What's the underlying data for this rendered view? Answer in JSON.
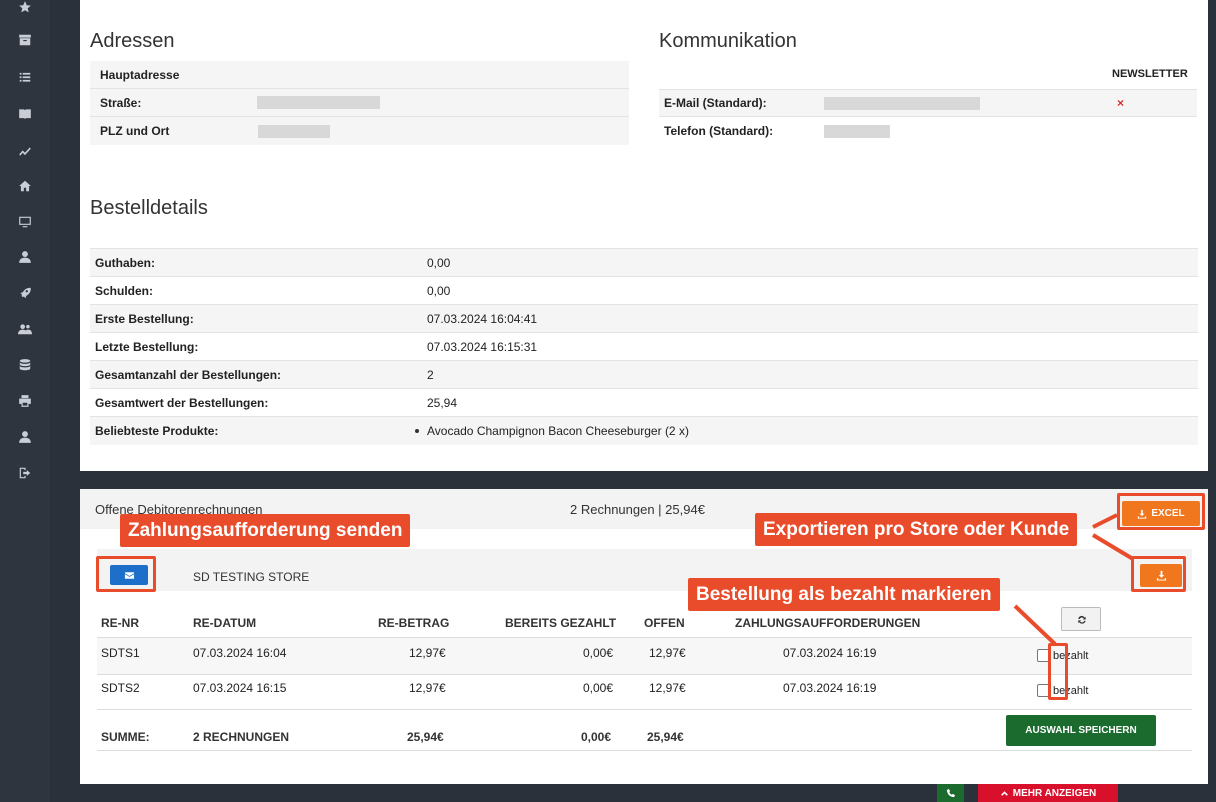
{
  "sidebar": {
    "items": [
      {
        "icon": "star-icon"
      },
      {
        "icon": "archive-icon"
      },
      {
        "icon": "list-icon"
      },
      {
        "icon": "book-icon"
      },
      {
        "icon": "chart-line-icon"
      },
      {
        "icon": "home-icon"
      },
      {
        "icon": "monitor-icon"
      },
      {
        "icon": "user-icon"
      },
      {
        "icon": "rocket-icon"
      },
      {
        "icon": "users-icon"
      },
      {
        "icon": "database-icon"
      },
      {
        "icon": "printer-icon"
      },
      {
        "icon": "user-icon"
      },
      {
        "icon": "logout-icon"
      }
    ]
  },
  "adressen": {
    "title": "Adressen",
    "rows": [
      {
        "label": "Hauptadresse"
      },
      {
        "label": "Straße:"
      },
      {
        "label": "PLZ und Ort"
      }
    ]
  },
  "kommunikation": {
    "title": "Kommunikation",
    "newsletter_header": "NEWSLETTER",
    "rows": [
      {
        "label": "E-Mail (Standard):",
        "newsletter": "×"
      },
      {
        "label": "Telefon (Standard):"
      }
    ]
  },
  "bestelldetails": {
    "title": "Bestelldetails",
    "rows": [
      {
        "label": "Guthaben:",
        "value": "0,00"
      },
      {
        "label": "Schulden:",
        "value": "0,00"
      },
      {
        "label": "Erste Bestellung:",
        "value": "07.03.2024 16:04:41"
      },
      {
        "label": "Letzte Bestellung:",
        "value": "07.03.2024 16:15:31"
      },
      {
        "label": "Gesamtanzahl der Bestellungen:",
        "value": "2"
      },
      {
        "label": "Gesamtwert der Bestellungen:",
        "value": "25,94"
      },
      {
        "label": "Beliebteste Produkte:",
        "value": "Avocado Champignon Bacon Cheeseburger (2 x)"
      }
    ]
  },
  "offene": {
    "title": "Offene Debitorenrechnungen",
    "summary": "2 Rechnungen | 25,94€",
    "excel_label": "EXCEL",
    "store_name": "SD TESTING STORE",
    "columns": [
      "RE-NR",
      "RE-DATUM",
      "RE-BETRAG",
      "BEREITS GEZAHLT",
      "OFFEN",
      "ZAHLUNGSAUFFORDERUNGEN"
    ],
    "rows": [
      {
        "nr": "SDTS1",
        "datum": "07.03.2024 16:04",
        "betrag": "12,97€",
        "gezahlt": "0,00€",
        "offen": "12,97€",
        "aufforderung": "07.03.2024 16:19",
        "checkbox_label": "bezahlt"
      },
      {
        "nr": "SDTS2",
        "datum": "07.03.2024 16:15",
        "betrag": "12,97€",
        "gezahlt": "0,00€",
        "offen": "12,97€",
        "aufforderung": "07.03.2024 16:19",
        "checkbox_label": "bezahlt"
      }
    ],
    "sum": {
      "label": "SUMME:",
      "count": "2 RECHNUNGEN",
      "betrag": "25,94€",
      "gezahlt": "0,00€",
      "offen": "25,94€"
    },
    "save_label": "AUSWAHL SPEICHERN"
  },
  "annotations": {
    "send_reminder": "Zahlungsaufforderung senden",
    "export": "Exportieren pro Store oder Kunde",
    "mark_paid": "Bestellung als bezahlt markieren"
  },
  "footer": {
    "more_label": "MEHR ANZEIGEN"
  },
  "colors": {
    "accent_orange": "#f1771f",
    "primary_blue": "#1d6fc9",
    "success_green": "#1b6a2e",
    "annotation_red": "#e94c2b"
  }
}
